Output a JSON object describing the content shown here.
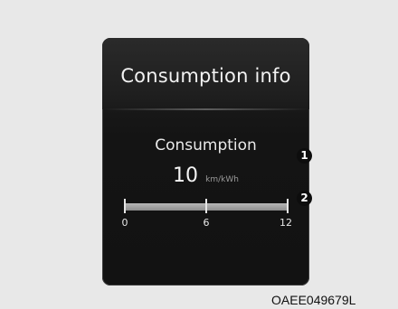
{
  "screen": {
    "title": "Consumption info",
    "metric_label": "Consumption",
    "value": "10",
    "unit": "km/kWh"
  },
  "scale": {
    "min_label": "0",
    "mid_label": "6",
    "max_label": "12"
  },
  "callouts": {
    "item1": "1",
    "item2": "2"
  },
  "figure_code": "OAEE049679L"
}
